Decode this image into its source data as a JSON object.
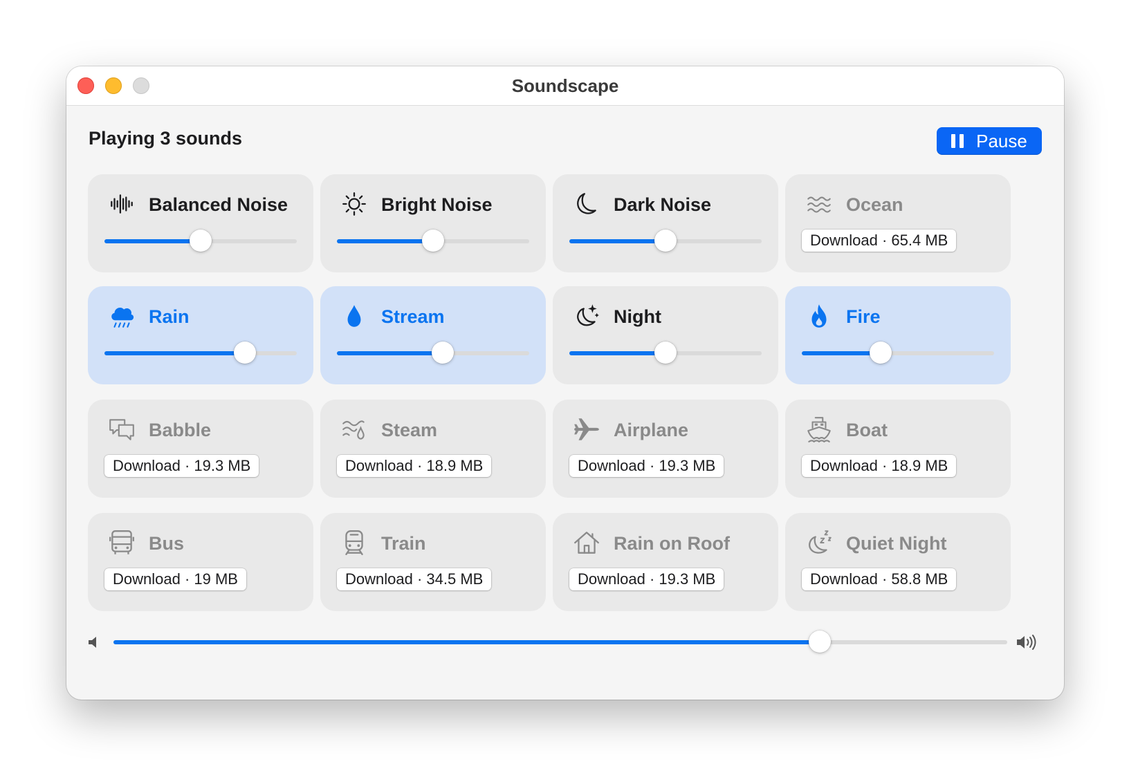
{
  "window": {
    "title": "Soundscape"
  },
  "header": {
    "status": "Playing 3 sounds",
    "pause_label": "Pause"
  },
  "colors": {
    "accent": "#0a74f0",
    "active_tile": "#d2e1f8",
    "tile": "#e9e9e9"
  },
  "volume": {
    "level": 0.79
  },
  "sounds": [
    {
      "name": "Balanced Noise",
      "icon": "waveform-icon",
      "state": "slider",
      "level": 0.5
    },
    {
      "name": "Bright Noise",
      "icon": "sun-icon",
      "state": "slider",
      "level": 0.5
    },
    {
      "name": "Dark Noise",
      "icon": "moon-icon",
      "state": "slider",
      "level": 0.5
    },
    {
      "name": "Ocean",
      "icon": "waves-icon",
      "state": "download",
      "download": "Download · 65.4 MB"
    },
    {
      "name": "Rain",
      "icon": "cloud-rain-icon",
      "state": "active",
      "level": 0.73
    },
    {
      "name": "Stream",
      "icon": "drop-icon",
      "state": "active",
      "level": 0.55
    },
    {
      "name": "Night",
      "icon": "moon-stars-icon",
      "state": "slider",
      "level": 0.5
    },
    {
      "name": "Fire",
      "icon": "flame-icon",
      "state": "active",
      "level": 0.41
    },
    {
      "name": "Babble",
      "icon": "speech-bubbles-icon",
      "state": "download",
      "download": "Download · 19.3 MB"
    },
    {
      "name": "Steam",
      "icon": "steam-icon",
      "state": "download",
      "download": "Download · 18.9 MB"
    },
    {
      "name": "Airplane",
      "icon": "airplane-icon",
      "state": "download",
      "download": "Download · 19.3 MB"
    },
    {
      "name": "Boat",
      "icon": "ferry-icon",
      "state": "download",
      "download": "Download · 18.9 MB"
    },
    {
      "name": "Bus",
      "icon": "bus-icon",
      "state": "download",
      "download": "Download · 19 MB"
    },
    {
      "name": "Train",
      "icon": "train-icon",
      "state": "download",
      "download": "Download · 34.5 MB"
    },
    {
      "name": "Rain on Roof",
      "icon": "house-icon",
      "state": "download",
      "download": "Download · 19.3 MB"
    },
    {
      "name": "Quiet Night",
      "icon": "moon-zzz-icon",
      "state": "download",
      "download": "Download · 58.8 MB"
    }
  ]
}
